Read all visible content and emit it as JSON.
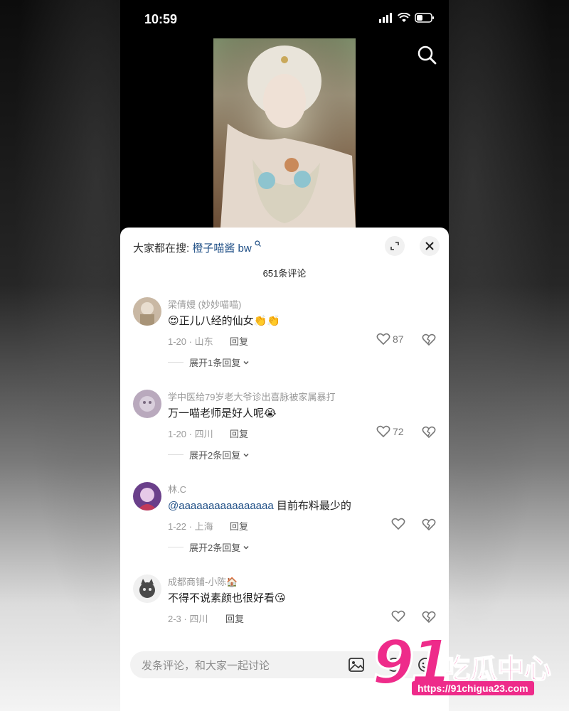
{
  "status_bar": {
    "time": "10:59"
  },
  "sheet": {
    "trending_label": "大家都在搜:",
    "trending_term": "橙子喵酱 bw",
    "comment_count": "651条评论"
  },
  "comments": [
    {
      "name": "梁倩嫚 (妙妙喵喵)",
      "text": "😍正儿八经的仙女👏👏",
      "meta": "1-20 · 山东",
      "reply": "回复",
      "likes": "87",
      "expand": "展开1条回复"
    },
    {
      "name": "学中医给79岁老大爷诊出喜脉被家属暴打",
      "text": "万一喵老师是好人呢😭",
      "meta": "1-20 · 四川",
      "reply": "回复",
      "likes": "72",
      "expand": "展开2条回复"
    },
    {
      "name": "林.C",
      "mention": "@aaaaaaaaaaaaaaaa",
      "text": " 目前布料最少的",
      "meta": "1-22 · 上海",
      "reply": "回复",
      "likes": "",
      "expand": "展开2条回复"
    },
    {
      "name": "成都商铺-小陈🏠",
      "text": "不得不说素颜也很好看😘",
      "meta": "2-3 · 四川",
      "reply": "回复",
      "likes": ""
    }
  ],
  "composer": {
    "placeholder": "发条评论，和大家一起讨论"
  },
  "watermark": {
    "number": "91",
    "brand": "吃瓜中心",
    "url": "https://91chigua23.com"
  },
  "icons": {
    "search": "search-icon",
    "expand": "expand-icon",
    "close": "close-icon",
    "like": "heart-icon",
    "dislike": "broken-heart-icon",
    "image": "image-icon",
    "mention": "at-icon",
    "emoji": "emoji-icon",
    "chevron": "chevron-down-icon"
  },
  "colors": {
    "link": "#1f4f86",
    "watermark": "#ee2b8a"
  }
}
